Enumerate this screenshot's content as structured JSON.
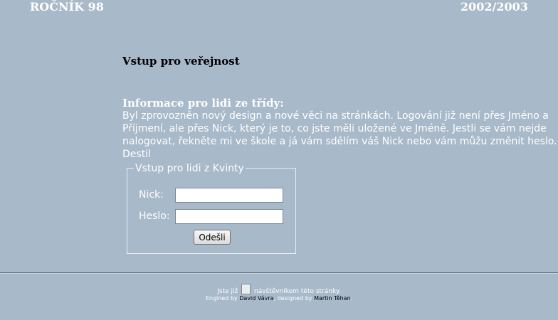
{
  "header": {
    "left": "ROČNÍK 98",
    "right": "2002/2003"
  },
  "main": {
    "title": "Vstup pro veřejnost",
    "info_heading": "Informace pro lidi ze třídy:",
    "info_text": "Byl zprovozněn nový design a nové věci na stránkách. Logování již není přes Jméno a Příjmení, ale přes Nick, který je to, co jste měli uložené ve Jméně. Jestli se vám nejde nalogovat, řekněte mi ve škole a já vám sdělím váš Nick nebo vám můžu změnit heslo.",
    "signature": "Destil"
  },
  "login": {
    "legend": "Vstup pro lidi z Kvinty",
    "nick_label": "Nick:",
    "nick_value": "",
    "password_label": "Heslo:",
    "password_value": "",
    "submit_label": "Odešli"
  },
  "footer": {
    "visitors_prefix": "Jste již",
    "visitors_suffix": "návštěvníkem této stránky.",
    "engined_by": "Engined by",
    "engine_author": "David Vávra",
    "designed_by": ", designed by",
    "designer": "Martin Těhan",
    "end": "."
  }
}
